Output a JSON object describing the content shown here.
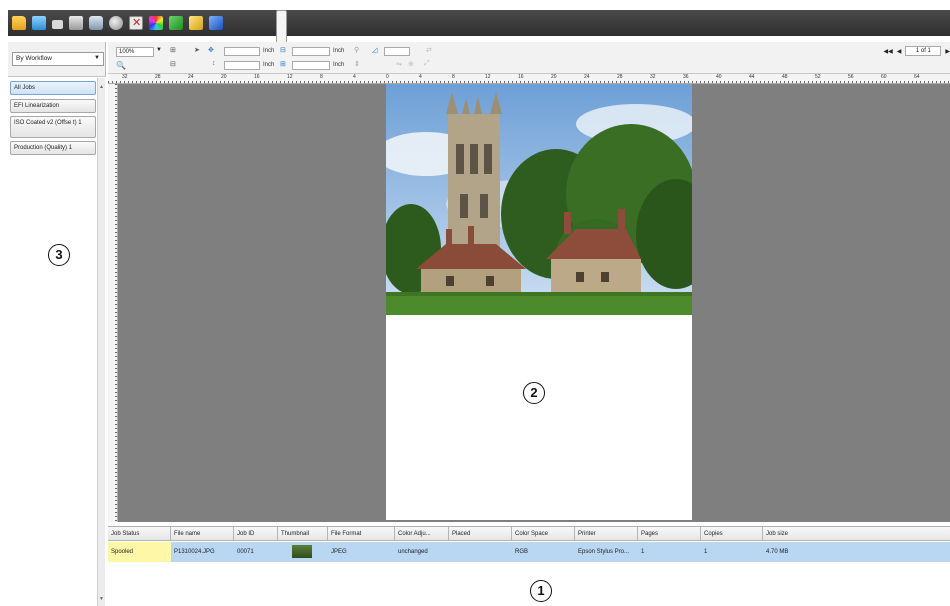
{
  "toolbar": {
    "icons": [
      "open-folder-icon",
      "folder-icon",
      "list-icon",
      "print-icon",
      "print-settings-icon",
      "printer-icon",
      "delete-icon",
      "color-icon",
      "green-tool-icon",
      "yellow-tool-icon",
      "book-icon",
      "page-icon"
    ]
  },
  "sidebar": {
    "workflow_select": "By Workflow",
    "items": [
      {
        "label": "All Jobs",
        "active": true
      },
      {
        "label": "EFI Linearization"
      },
      {
        "label": "ISO Coated v2 (Offse t) 1"
      },
      {
        "label": "Production (Quality) 1"
      }
    ]
  },
  "options": {
    "zoom": "100%",
    "unit_1": "Inch",
    "unit_2": "Inch",
    "unit_3": "Inch",
    "unit_4": "Inch",
    "page_indicator": "1 of 1"
  },
  "ruler": {
    "labels": [
      "32",
      "28",
      "24",
      "20",
      "16",
      "12",
      "8",
      "4",
      "0",
      "4",
      "8",
      "12",
      "16",
      "20",
      "24",
      "28",
      "32",
      "36",
      "40",
      "44",
      "48",
      "52",
      "56",
      "60",
      "64"
    ]
  },
  "table": {
    "columns": [
      "Job Status",
      "File name",
      "Job ID",
      "Thumbnail",
      "File Format",
      "Color Adju...",
      "Placed",
      "Color Space",
      "Printer",
      "Pages",
      "Copies",
      "Job size"
    ],
    "rows": [
      {
        "status": "Spooled",
        "file_name": "P1310024.JPG",
        "job_id": "00071",
        "format": "JPEG",
        "color_adjust": "unchanged",
        "placed": "",
        "color_space": "RGB",
        "printer": "Epson Stylus Pro...",
        "pages": "1",
        "copies": "1",
        "job_size": "4.70 MB"
      }
    ]
  },
  "callouts": {
    "c1": "1",
    "c2": "2",
    "c3": "3"
  },
  "colors": {
    "canvas": "#7f7f7f",
    "selected_row": "#b9d6f2",
    "status_highlight": "#fff7a8"
  }
}
